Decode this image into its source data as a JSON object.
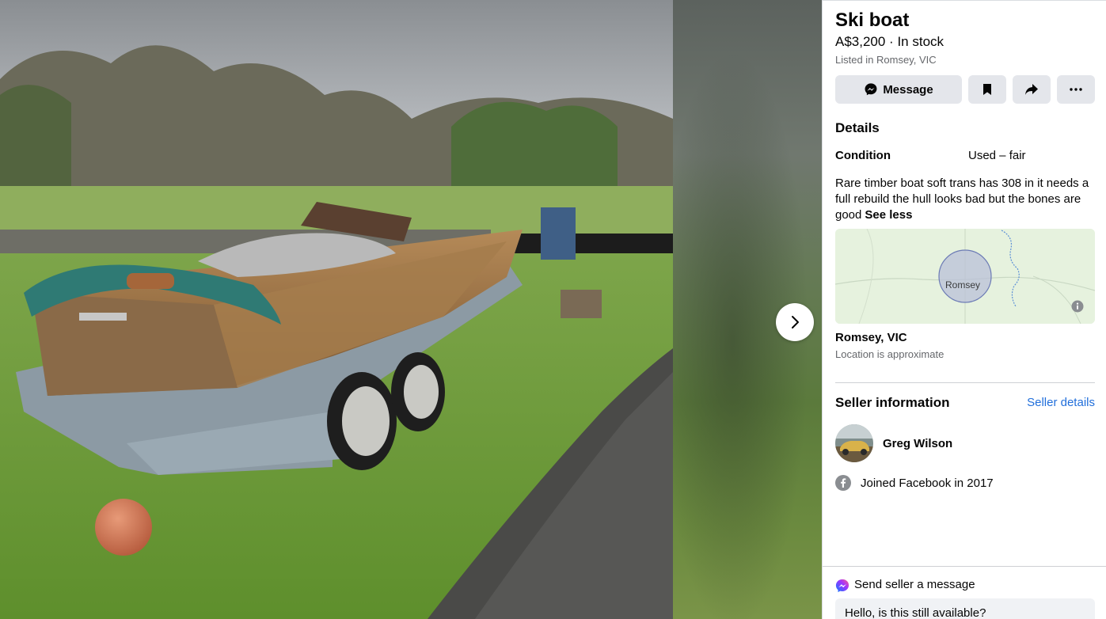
{
  "listing": {
    "title": "Ski boat",
    "price_line": "A$3,200 · In stock",
    "listed_in": "Listed in Romsey, VIC"
  },
  "actions": {
    "message_label": "Message",
    "save_icon": "bookmark-icon",
    "share_icon": "share-icon",
    "more_icon": "more-icon"
  },
  "details": {
    "heading": "Details",
    "condition_label": "Condition",
    "condition_value": "Used – fair",
    "description": "Rare timber boat soft trans has 308 in it needs a full rebuild  the hull looks bad but the bones are good",
    "see_less": "See less"
  },
  "map": {
    "marker_label": "Romsey",
    "location_title": "Romsey, VIC",
    "location_sub": "Location is approximate",
    "info_icon": "info-icon"
  },
  "seller": {
    "heading": "Seller information",
    "details_link": "Seller details",
    "name": "Greg Wilson",
    "joined": "Joined Facebook in 2017"
  },
  "message_box": {
    "label": "Send seller a message",
    "input_value": "Hello, is this still available?"
  },
  "colors": {
    "link": "#216fdb",
    "button_bg": "#e4e6eb",
    "secondary_text": "#65676b"
  }
}
